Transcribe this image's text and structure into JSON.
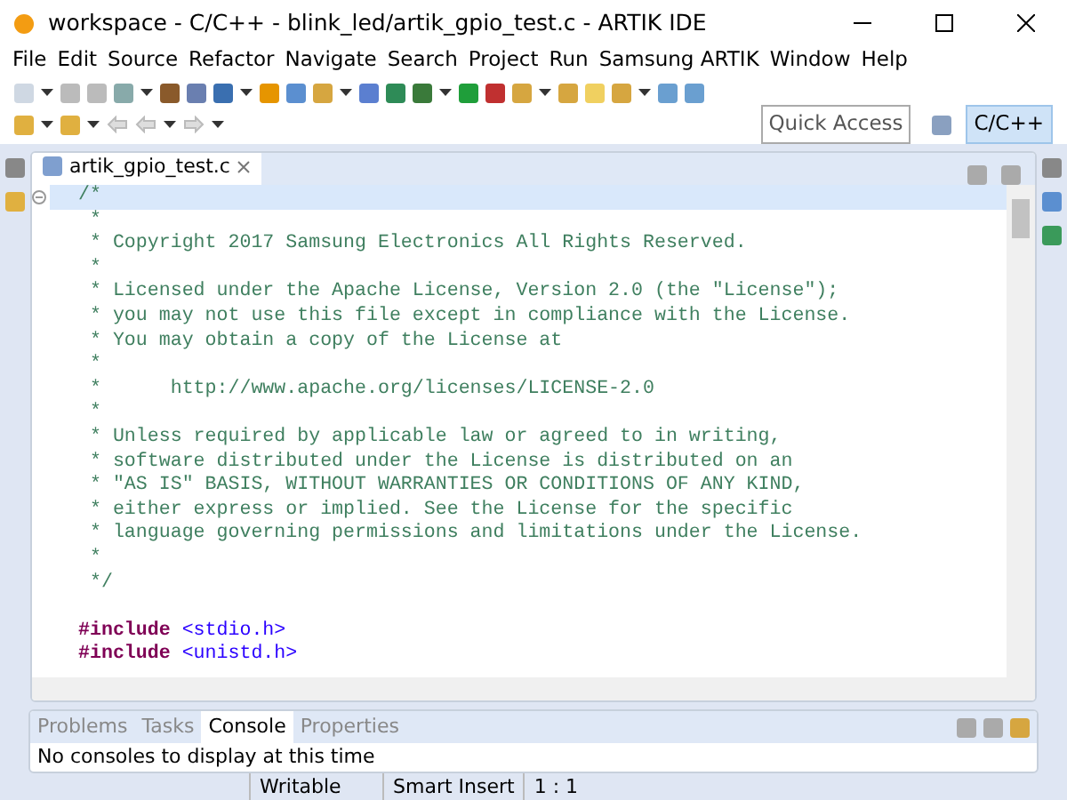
{
  "window": {
    "title": "workspace - C/C++ - blink_led/artik_gpio_test.c - ARTIK IDE"
  },
  "menu": [
    "File",
    "Edit",
    "Source",
    "Refactor",
    "Navigate",
    "Search",
    "Project",
    "Run",
    "Samsung ARTIK",
    "Window",
    "Help"
  ],
  "quick_access": {
    "placeholder": "Quick Access"
  },
  "perspective": {
    "label": "C/C++",
    "selected": true
  },
  "editor": {
    "tab": "artik_gpio_test.c",
    "lines": [
      {
        "kind": "comment",
        "text": "/*",
        "current": true
      },
      {
        "kind": "comment",
        "text": " *",
        "current": false
      },
      {
        "kind": "comment",
        "text": " * Copyright 2017 Samsung Electronics All Rights Reserved.",
        "current": false
      },
      {
        "kind": "comment",
        "text": " *",
        "current": false
      },
      {
        "kind": "comment",
        "text": " * Licensed under the Apache License, Version 2.0 (the \"License\");",
        "current": false
      },
      {
        "kind": "comment",
        "text": " * you may not use this file except in compliance with the License.",
        "current": false
      },
      {
        "kind": "comment",
        "text": " * You may obtain a copy of the License at",
        "current": false
      },
      {
        "kind": "comment",
        "text": " *",
        "current": false
      },
      {
        "kind": "comment",
        "text": " *      http://www.apache.org/licenses/LICENSE-2.0",
        "current": false
      },
      {
        "kind": "comment",
        "text": " *",
        "current": false
      },
      {
        "kind": "comment",
        "text": " * Unless required by applicable law or agreed to in writing,",
        "current": false
      },
      {
        "kind": "comment",
        "text": " * software distributed under the License is distributed on an",
        "current": false
      },
      {
        "kind": "comment",
        "text": " * \"AS IS\" BASIS, WITHOUT WARRANTIES OR CONDITIONS OF ANY KIND,",
        "current": false
      },
      {
        "kind": "comment",
        "text": " * either express or implied. See the License for the specific",
        "current": false
      },
      {
        "kind": "comment",
        "text": " * language governing permissions and limitations under the License.",
        "current": false
      },
      {
        "kind": "comment",
        "text": " *",
        "current": false
      },
      {
        "kind": "comment",
        "text": " */",
        "current": false
      },
      {
        "kind": "blank",
        "current": false
      },
      {
        "kind": "include",
        "directive": "#include",
        "header": "<stdio.h>",
        "current": false
      },
      {
        "kind": "include",
        "directive": "#include",
        "header": "<unistd.h>",
        "current": false
      }
    ]
  },
  "bottom_tabs": [
    {
      "label": "Problems",
      "selected": false
    },
    {
      "label": "Tasks",
      "selected": false
    },
    {
      "label": "Console",
      "selected": true
    },
    {
      "label": "Properties",
      "selected": false
    }
  ],
  "console_message": "No consoles to display at this time",
  "status_bar": [
    "Writable",
    "Smart Insert",
    "1 : 1"
  ]
}
